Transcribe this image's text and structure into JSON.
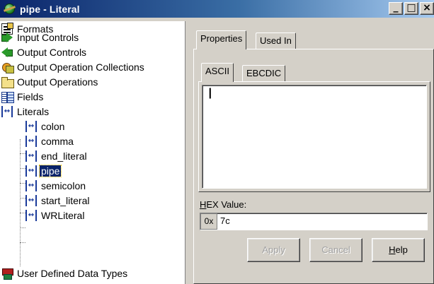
{
  "window": {
    "title": "pipe - Literal",
    "controls": {
      "minimize": "_",
      "maximize": "□",
      "close": "×"
    }
  },
  "tree": {
    "items": [
      {
        "label": "Formats",
        "icon": "formats-icon"
      },
      {
        "label": "Input Controls",
        "icon": "input-arrow-icon"
      },
      {
        "label": "Output Controls",
        "icon": "output-arrow-icon"
      },
      {
        "label": "Output Operation Collections",
        "icon": "operation-collection-icon"
      },
      {
        "label": "Output Operations",
        "icon": "folder-icon"
      },
      {
        "label": "Fields",
        "icon": "fields-icon"
      },
      {
        "label": "Literals",
        "icon": "literal-icon"
      },
      {
        "label": "User Defined Data Types",
        "icon": "user-data-types-icon"
      }
    ],
    "literals": [
      {
        "label": "colon",
        "selected": false
      },
      {
        "label": "comma",
        "selected": false
      },
      {
        "label": "end_literal",
        "selected": false
      },
      {
        "label": "pipe",
        "selected": true
      },
      {
        "label": "semicolon",
        "selected": false
      },
      {
        "label": "start_literal",
        "selected": false
      },
      {
        "label": "WRLiteral",
        "selected": false
      }
    ],
    "literal_icon_glyph": "↔",
    "selection_color": "#0a246a"
  },
  "tabs": {
    "outer": [
      {
        "label": "Properties",
        "active": true
      },
      {
        "label": "Used In",
        "active": false
      }
    ],
    "inner": [
      {
        "label": "ASCII",
        "active": true
      },
      {
        "label": "EBCDIC",
        "active": false
      }
    ]
  },
  "ascii_content": "|",
  "hex": {
    "label_mnemonic": "H",
    "label_rest": "EX Value:",
    "prefix": "0x",
    "value": "7c"
  },
  "buttons": {
    "apply": "Apply",
    "cancel": "Cancel",
    "help_mnemonic": "H",
    "help_rest": "elp"
  }
}
